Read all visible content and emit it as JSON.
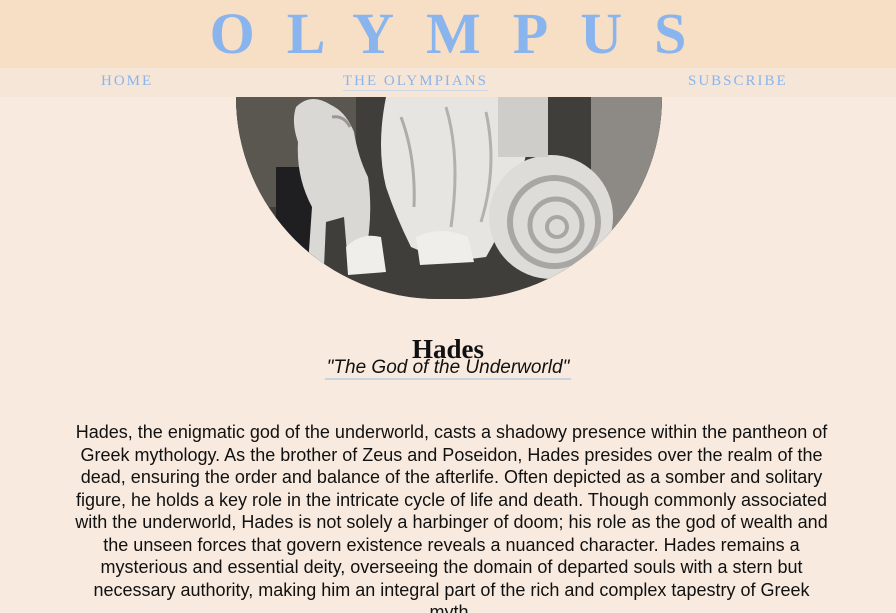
{
  "site": {
    "title": "OLYMPUS"
  },
  "nav": {
    "items": [
      {
        "label": "HOME"
      },
      {
        "label": "THE OLYMPIANS"
      },
      {
        "label": "SUBSCRIBE"
      }
    ]
  },
  "main": {
    "image": {
      "subject": "marble statue of Hades with Cerberus"
    },
    "name": "Hades",
    "epithet": "\"The God of the Underworld\"",
    "description": "Hades, the enigmatic god of the underworld, casts a shadowy presence within the pantheon of Greek mythology. As the brother of Zeus and Poseidon, Hades presides over the realm of the dead, ensuring the order and balance of the afterlife. Often depicted as a somber and solitary figure, he holds a key role in the intricate cycle of life and death. Though commonly associated with the underworld, Hades is not solely a harbinger of doom; his role as the god of wealth and the unseen forces that govern existence reveals a nuanced character. Hades remains a mysterious and essential deity, overseeing the domain of departed souls with a stern but necessary authority, making him an integral part of the rich and complex tapestry of Greek myth."
  },
  "colors": {
    "background": "#f8eadf",
    "header": "#f6dfc4",
    "accent": "#8ab4ee"
  }
}
